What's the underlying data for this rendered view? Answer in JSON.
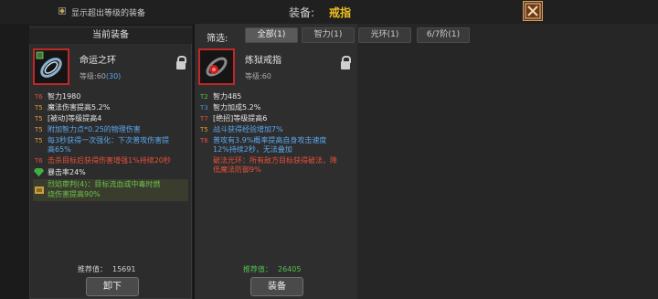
{
  "topbar": {
    "show_exceed_label": "显示超出等级的装备",
    "equip_label": "装备:",
    "equip_type": "戒指",
    "close_icon": "close-x-icon"
  },
  "left": {
    "header": "当前装备",
    "item_name": "命运之环",
    "level_prefix": "等级:60",
    "level_bonus": "(30)",
    "stats": [
      {
        "tier": "T6",
        "text": "智力1980"
      },
      {
        "tier": "T5",
        "text": "魔法伤害提高5.2%"
      },
      {
        "tier": "T5",
        "text": "[被动]等级提高4"
      },
      {
        "tier": "T5",
        "text": "附加智力点*0.25的物理伤害"
      },
      {
        "tier": "T5",
        "text": "每3秒获得一次强化：下次普攻伤害提"
      },
      {
        "tier": "",
        "text": "高65%"
      },
      {
        "tier": "T6",
        "text": "击杀目标后获得伤害增强1%持续20秒"
      },
      {
        "tier": "",
        "text": "暴击率24%"
      },
      {
        "tier": "",
        "text": "烈焰审判(4)：目标流血或中毒时燃"
      },
      {
        "tier": "",
        "text": "烧伤害提高90%"
      }
    ],
    "recommend_label": "推荐值：",
    "recommend_value": "15691",
    "unequip_button": "卸下"
  },
  "mid": {
    "filter_label": "筛选:",
    "filter_tabs": [
      "全部(1)",
      "智力(1)",
      "光环(1)",
      "6/7阶(1)"
    ],
    "item_name": "炼狱戒指",
    "level": "等级:60",
    "stats": [
      {
        "tier": "T2",
        "text": "智力485"
      },
      {
        "tier": "T3",
        "text": "智力加成5.2%"
      },
      {
        "tier": "T7",
        "text": "[绝招]等级提高6"
      },
      {
        "tier": "T5",
        "text": "战斗获得经验增加7%"
      },
      {
        "tier": "T6",
        "text": "普攻有3.9%概率提高自身攻击速度"
      },
      {
        "tier": "",
        "text": "12%持续2秒，无法叠加"
      },
      {
        "tier": "",
        "text": "破法光环：所有敌方目标获得破法，降"
      },
      {
        "tier": "",
        "text": "低魔法防御9%"
      }
    ],
    "recommend_label": "推荐值：",
    "recommend_value": "26405",
    "equip_button": "装备"
  },
  "colors": {
    "gold": "#f0c020",
    "stat_white": "#e6e6e6",
    "stat_blue": "#5aa8f0",
    "stat_red": "#e8503a",
    "stat_green": "#6cc04a",
    "tier_red": "#e05040",
    "tier_orange": "#e09a30",
    "tier_blue": "#4a90e0",
    "tier_green": "#50c050"
  }
}
